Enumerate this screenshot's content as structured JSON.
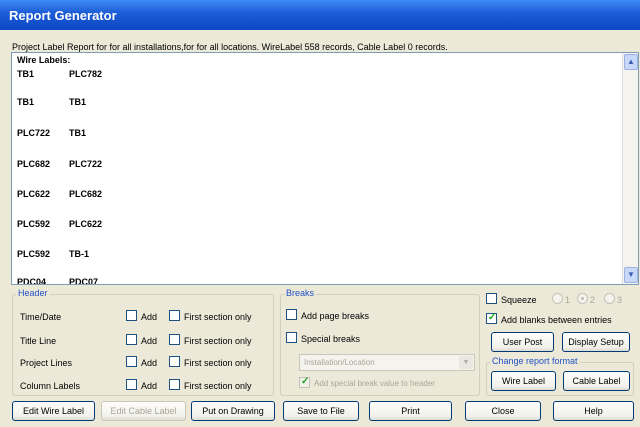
{
  "window": {
    "title": "Report Generator"
  },
  "report": {
    "summary": "Project Label Report for for all installations,for for all locations. WireLabel 558 records, Cable Label 0 records.",
    "heading": "Wire Labels:",
    "rows": [
      [
        "TB1",
        "PLC782"
      ],
      [
        "TB1",
        "TB1"
      ],
      [
        "PLC722",
        "TB1"
      ],
      [
        "PLC682",
        "PLC722"
      ],
      [
        "PLC622",
        "PLC682"
      ],
      [
        "PLC592",
        "PLC622"
      ],
      [
        "PLC592",
        "TB-1"
      ],
      [
        "PDC04",
        "PDC07"
      ]
    ]
  },
  "header_group": {
    "title": "Header",
    "rows": [
      {
        "label": "Time/Date",
        "add": "Add",
        "first": "First section only"
      },
      {
        "label": "Title Line",
        "add": "Add",
        "first": "First section only"
      },
      {
        "label": "Project Lines",
        "add": "Add",
        "first": "First section only"
      },
      {
        "label": "Column Labels",
        "add": "Add",
        "first": "First section only"
      }
    ]
  },
  "breaks_group": {
    "title": "Breaks",
    "add_page_breaks": "Add page breaks",
    "special_breaks": "Special breaks",
    "combo_value": "Installation/Location",
    "add_special_value": "Add special break value to header"
  },
  "right_panel": {
    "squeeze": "Squeeze",
    "radio_1": "1",
    "radio_2": "2",
    "radio_3": "3",
    "add_blanks": "Add blanks between entries",
    "user_post": "User Post",
    "display_setup": "Display Setup",
    "change_format_title": "Change report format",
    "wire_label": "Wire Label",
    "cable_label": "Cable Label"
  },
  "bottom_buttons": {
    "edit_wire": "Edit Wire Label",
    "edit_cable": "Edit Cable Label",
    "put_on_drawing": "Put on Drawing",
    "save_to_file": "Save to File",
    "print": "Print",
    "close": "Close",
    "help": "Help"
  },
  "colors": {
    "title_bar": "#0b46c4",
    "group_label": "#2151c7",
    "window_bg": "#ece9d8"
  }
}
